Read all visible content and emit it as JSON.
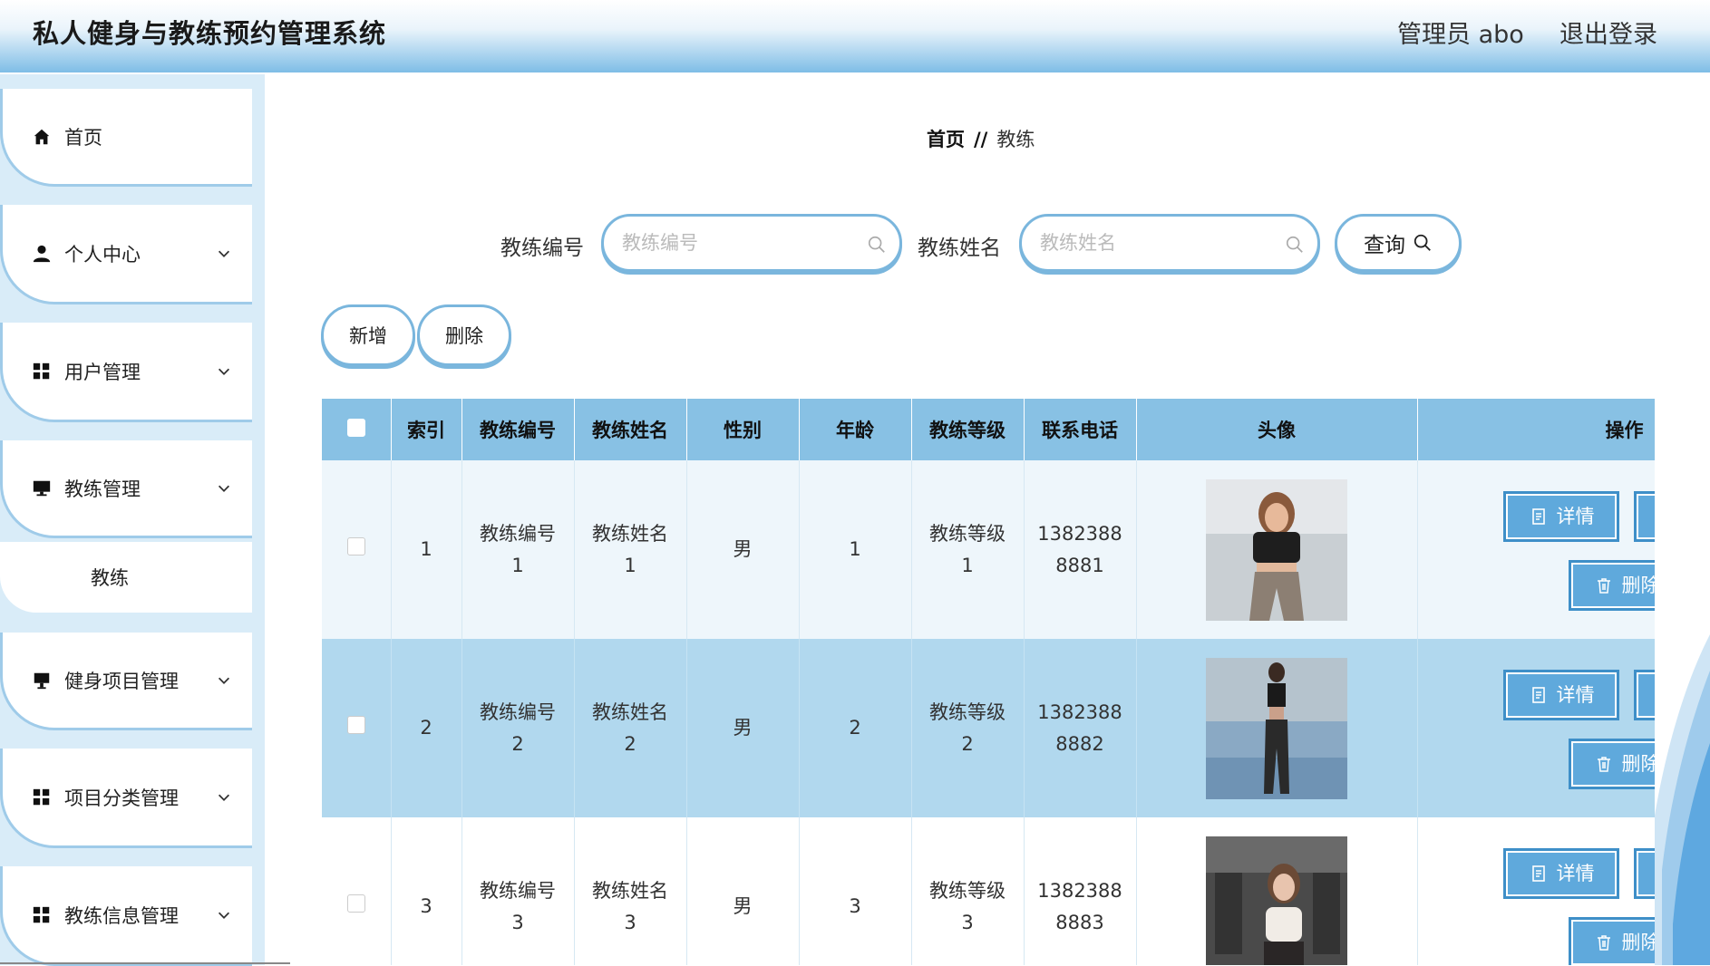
{
  "header": {
    "title": "私人健身与教练预约管理系统",
    "admin": "管理员 abo",
    "logout": "退出登录"
  },
  "sidebar": {
    "items": [
      {
        "label": "首页",
        "icon": "home-icon"
      },
      {
        "label": "个人中心",
        "icon": "user-icon"
      },
      {
        "label": "用户管理",
        "icon": "grid-icon"
      },
      {
        "label": "教练管理",
        "icon": "monitor-icon"
      },
      {
        "label": "健身项目管理",
        "icon": "monitor-icon"
      },
      {
        "label": "项目分类管理",
        "icon": "grid-icon"
      },
      {
        "label": "教练信息管理",
        "icon": "grid-icon"
      }
    ],
    "sub_item": "教练"
  },
  "breadcrumb": {
    "home": "首页",
    "sep": "//",
    "current": "教练"
  },
  "search": {
    "id_label": "教练编号",
    "id_placeholder": "教练编号",
    "name_label": "教练姓名",
    "name_placeholder": "教练姓名",
    "query_label": "查询"
  },
  "actions": {
    "add": "新增",
    "delete": "删除"
  },
  "table": {
    "headers": [
      "索引",
      "教练编号",
      "教练姓名",
      "性别",
      "年龄",
      "教练等级",
      "联系电话",
      "头像",
      "操作"
    ],
    "rows": [
      {
        "index": "1",
        "id_line1": "教练编号",
        "id_line2": "1",
        "name_line1": "教练姓名",
        "name_line2": "1",
        "gender": "男",
        "age": "1",
        "level_line1": "教练等级",
        "level_line2": "1",
        "phone_line1": "1382388",
        "phone_line2": "8881"
      },
      {
        "index": "2",
        "id_line1": "教练编号",
        "id_line2": "2",
        "name_line1": "教练姓名",
        "name_line2": "2",
        "gender": "男",
        "age": "2",
        "level_line1": "教练等级",
        "level_line2": "2",
        "phone_line1": "1382388",
        "phone_line2": "8882"
      },
      {
        "index": "3",
        "id_line1": "教练编号",
        "id_line2": "3",
        "name_line1": "教练姓名",
        "name_line2": "3",
        "gender": "男",
        "age": "3",
        "level_line1": "教练等级",
        "level_line2": "3",
        "phone_line1": "1382388",
        "phone_line2": "8883"
      }
    ],
    "detail_label": "详情",
    "delete_label": "删除"
  },
  "colors": {
    "accent": "#5fa9dc",
    "header_bg": "#88c1e4",
    "sidebar_bg": "#d9ecf8"
  }
}
